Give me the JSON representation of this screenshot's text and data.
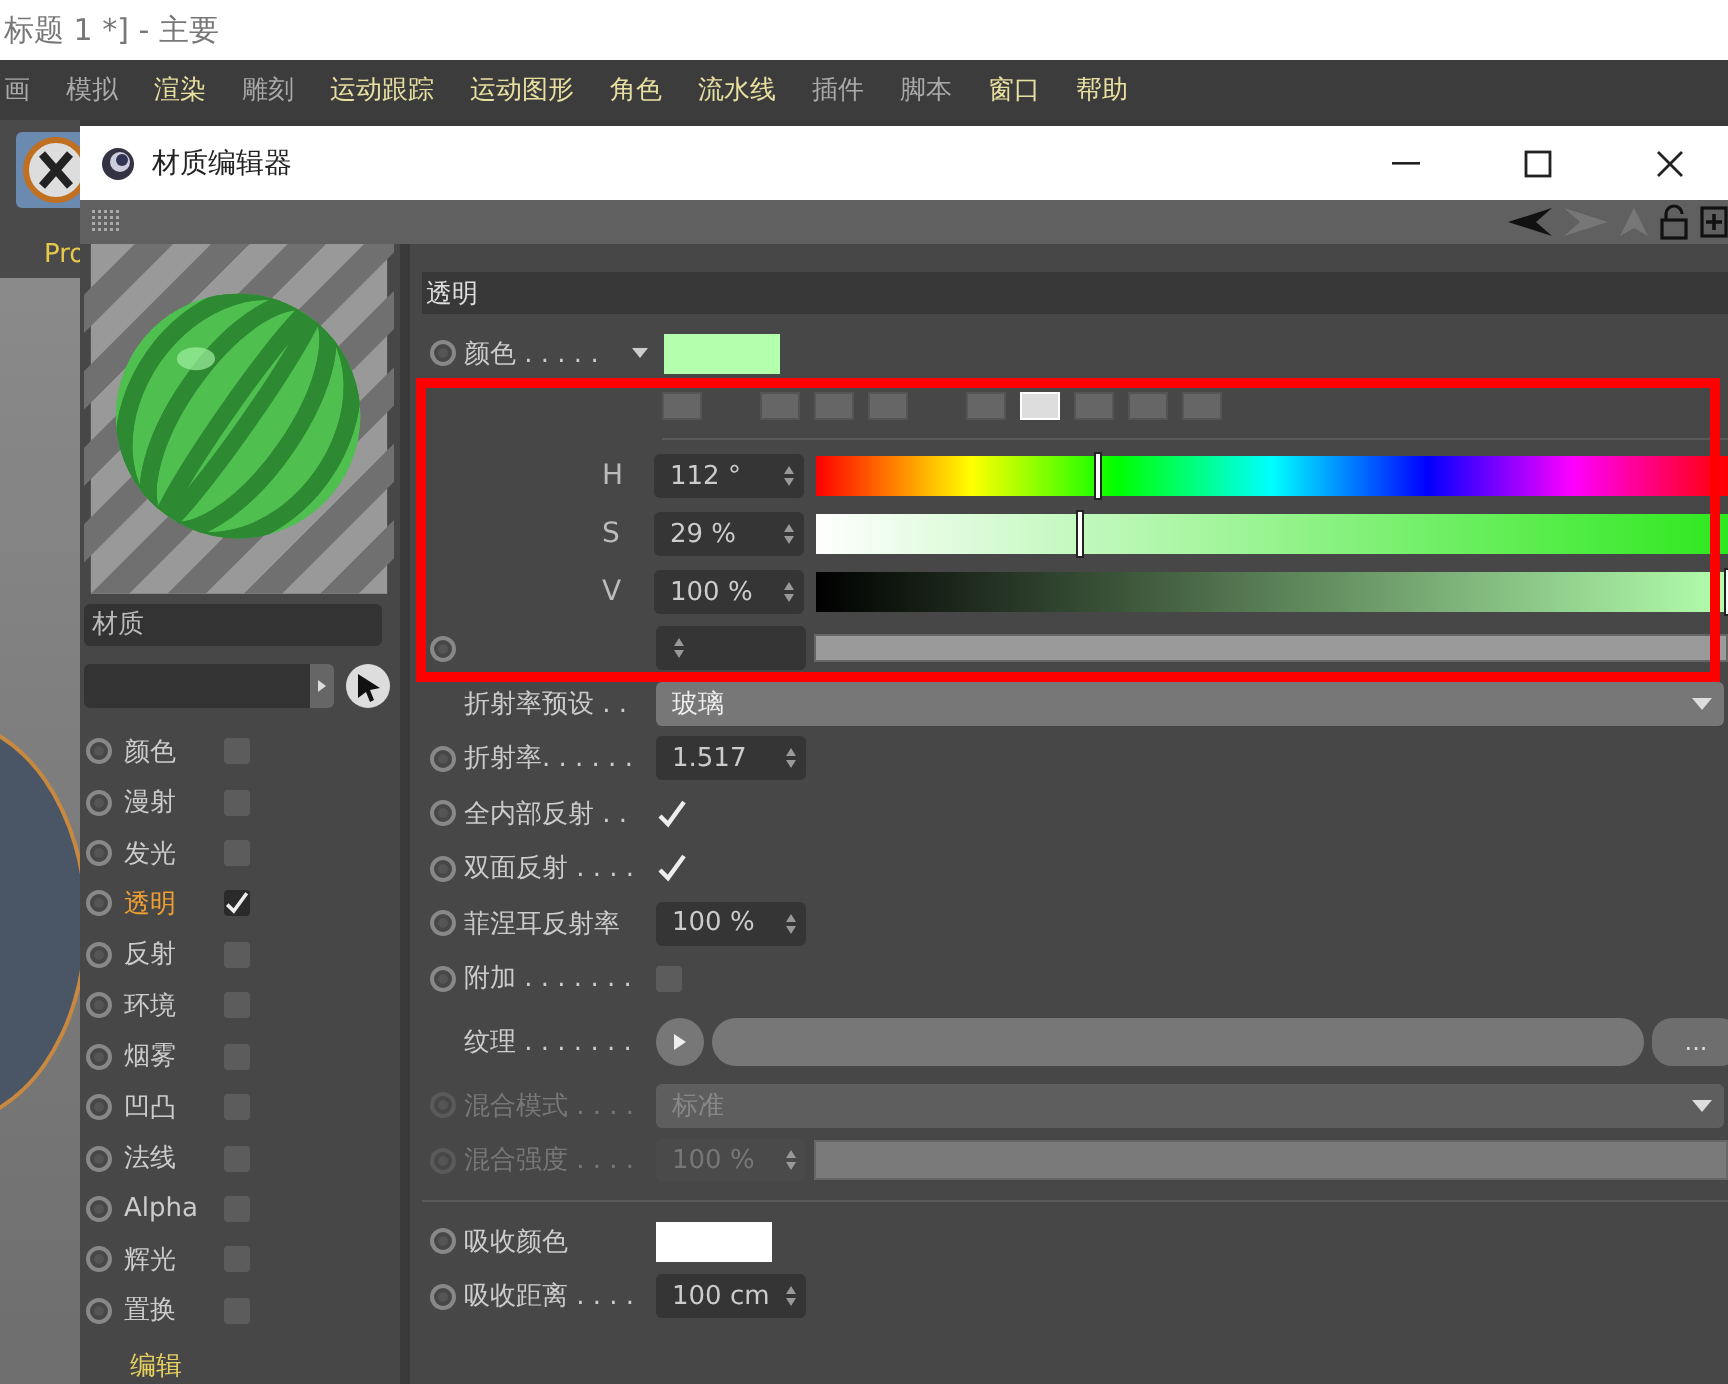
{
  "app_title": "标题 1 *] - 主要",
  "menu": [
    {
      "label": "画",
      "accent": false
    },
    {
      "label": "模拟",
      "accent": false
    },
    {
      "label": "渲染",
      "accent": true
    },
    {
      "label": "雕刻",
      "accent": false
    },
    {
      "label": "运动跟踪",
      "accent": true
    },
    {
      "label": "运动图形",
      "accent": true
    },
    {
      "label": "角色",
      "accent": true
    },
    {
      "label": "流水线",
      "accent": true
    },
    {
      "label": "插件",
      "accent": false
    },
    {
      "label": "脚本",
      "accent": false
    },
    {
      "label": "窗口",
      "accent": true
    },
    {
      "label": "帮助",
      "accent": true
    }
  ],
  "background_tab": "Pro",
  "window": {
    "title": "材质编辑器"
  },
  "material": {
    "name": "材质"
  },
  "channels": [
    {
      "label": "颜色",
      "checked": false,
      "selected": false
    },
    {
      "label": "漫射",
      "checked": false,
      "selected": false
    },
    {
      "label": "发光",
      "checked": false,
      "selected": false
    },
    {
      "label": "透明",
      "checked": true,
      "selected": true
    },
    {
      "label": "反射",
      "checked": false,
      "selected": false
    },
    {
      "label": "环境",
      "checked": false,
      "selected": false
    },
    {
      "label": "烟雾",
      "checked": false,
      "selected": false
    },
    {
      "label": "凹凸",
      "checked": false,
      "selected": false
    },
    {
      "label": "法线",
      "checked": false,
      "selected": false
    },
    {
      "label": "Alpha",
      "checked": false,
      "selected": false
    },
    {
      "label": "辉光",
      "checked": false,
      "selected": false
    },
    {
      "label": "置换",
      "checked": false,
      "selected": false
    }
  ],
  "edit_label": "编辑",
  "section_title": "透明",
  "color": {
    "label": "颜色 . . . . .",
    "color": "#b3ffad"
  },
  "color_modes": [
    {
      "selected": false
    },
    {
      "selected": false
    },
    {
      "selected": false
    },
    {
      "selected": false
    },
    {
      "selected": false
    },
    {
      "selected": true
    },
    {
      "selected": false
    },
    {
      "selected": false
    },
    {
      "selected": false
    }
  ],
  "hsv": [
    {
      "kind": "hue",
      "letter": "H",
      "value": "112 °",
      "level": 0.31
    },
    {
      "kind": "saturation",
      "letter": "S",
      "value": "29 %",
      "level": 0.29
    },
    {
      "kind": "value",
      "letter": "V",
      "value": "100 %",
      "level": 1
    }
  ],
  "brightness": {
    "level": 1
  },
  "params": [
    {
      "kind": "dropdown",
      "label": "折射率预设 . .",
      "keyframe": false,
      "disabled": false,
      "value": "玻璃"
    },
    {
      "kind": "number",
      "label": "折射率. . . . . .",
      "keyframe": true,
      "disabled": false,
      "value": "1.517"
    },
    {
      "kind": "checkbox",
      "label": "全内部反射 . .",
      "keyframe": true,
      "disabled": false,
      "checked": true
    },
    {
      "kind": "checkbox",
      "label": "双面反射 . . . .",
      "keyframe": true,
      "disabled": false,
      "checked": true
    },
    {
      "kind": "number",
      "label": "菲涅耳反射率",
      "keyframe": true,
      "disabled": false,
      "value": "100 %"
    },
    {
      "kind": "checkbox",
      "label": "附加 . . . . . . .",
      "keyframe": true,
      "disabled": false,
      "checked": false
    },
    {
      "kind": "texture",
      "label": "纹理 . . . . . . .",
      "keyframe": false,
      "disabled": false,
      "button": "..."
    },
    {
      "kind": "dropdown",
      "label": "混合模式 . . . .",
      "keyframe": true,
      "disabled": true,
      "value": "标准"
    },
    {
      "kind": "slider",
      "label": "混合强度 . . . .",
      "keyframe": true,
      "disabled": true,
      "value": "100 %",
      "level": 1
    },
    {
      "kind": "separator"
    },
    {
      "kind": "swatch",
      "label": "吸收颜色",
      "keyframe": true,
      "disabled": false,
      "color": "#ffffff"
    },
    {
      "kind": "number",
      "label": "吸收距离 . . . .",
      "keyframe": true,
      "disabled": false,
      "value": "100 cm"
    }
  ]
}
